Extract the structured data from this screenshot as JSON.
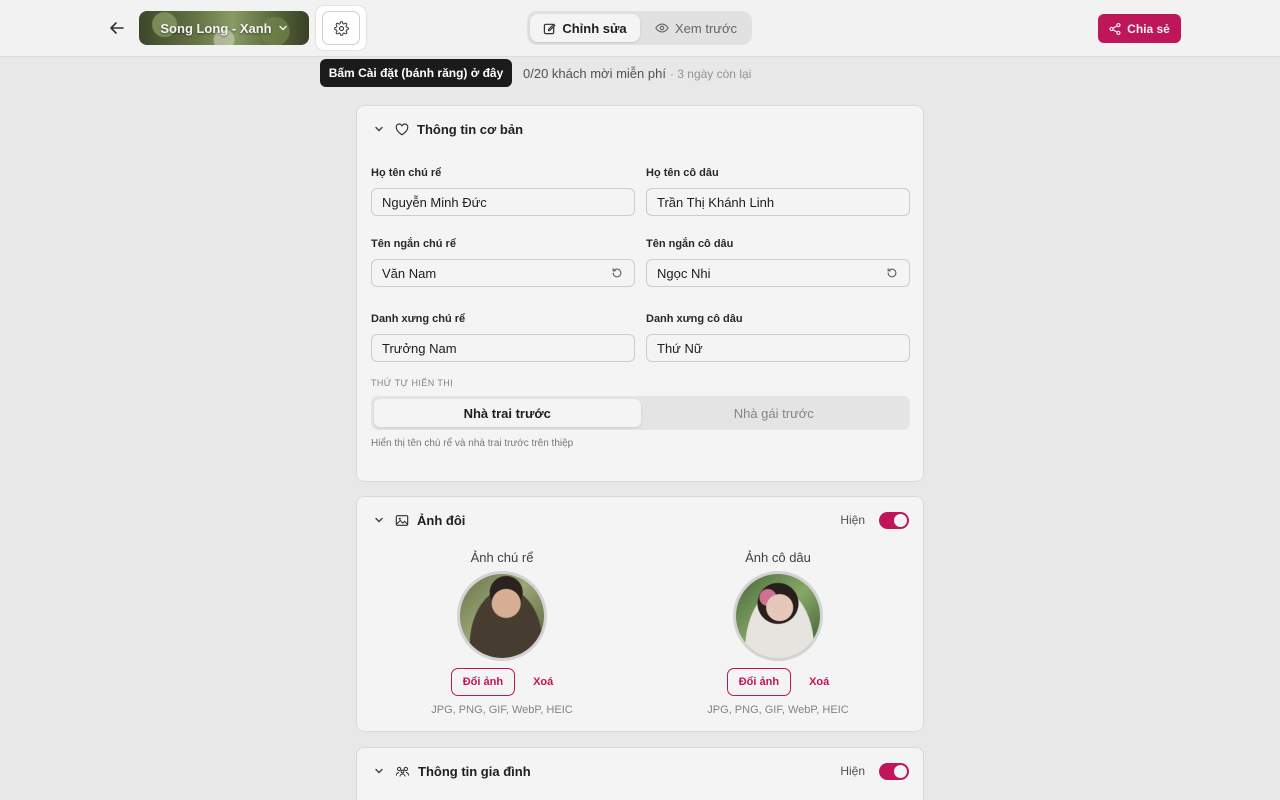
{
  "header": {
    "template_name": "Song Long - Xanh",
    "mode_tabs": {
      "edit": "Chỉnh sửa",
      "preview": "Xem trước"
    },
    "share_label": "Chia sẻ"
  },
  "tooltip": "Bấm Cài đặt (bánh răng) ở đây",
  "guest_info": {
    "count": "0/20 khách mời miễn phí",
    "remaining": "· 3 ngày còn lại"
  },
  "basic_info": {
    "title": "Thông tin cơ bản",
    "groom_full_label": "Họ tên chú rể",
    "groom_full_value": "Nguyễn Minh Đức",
    "bride_full_label": "Họ tên cô dâu",
    "bride_full_value": "Trần Thị Khánh Linh",
    "groom_short_label": "Tên ngắn chú rể",
    "groom_short_value": "Văn Nam",
    "bride_short_label": "Tên ngắn cô dâu",
    "bride_short_value": "Ngọc Nhi",
    "groom_title_label": "Danh xưng chú rể",
    "groom_title_value": "Trưởng Nam",
    "bride_title_label": "Danh xưng cô dâu",
    "bride_title_value": "Thứ Nữ",
    "order_caption": "THỨ TỰ HIỂN THỊ",
    "order_options": [
      "Nhà trai trước",
      "Nhà gái trước"
    ],
    "order_hint": "Hiển thị tên chú rể và nhà trai trước trên thiệp"
  },
  "couple_photos": {
    "title": "Ảnh đôi",
    "show_label": "Hiện",
    "groom_caption": "Ảnh chú rể",
    "bride_caption": "Ảnh cô dâu",
    "change_label": "Đổi ảnh",
    "delete_label": "Xoá",
    "formats": "JPG, PNG, GIF, WebP, HEIC"
  },
  "family_info": {
    "title": "Thông tin gia đình",
    "show_label": "Hiện"
  },
  "colors": {
    "accent": "#c8175d",
    "background": "#f3f3f3"
  }
}
